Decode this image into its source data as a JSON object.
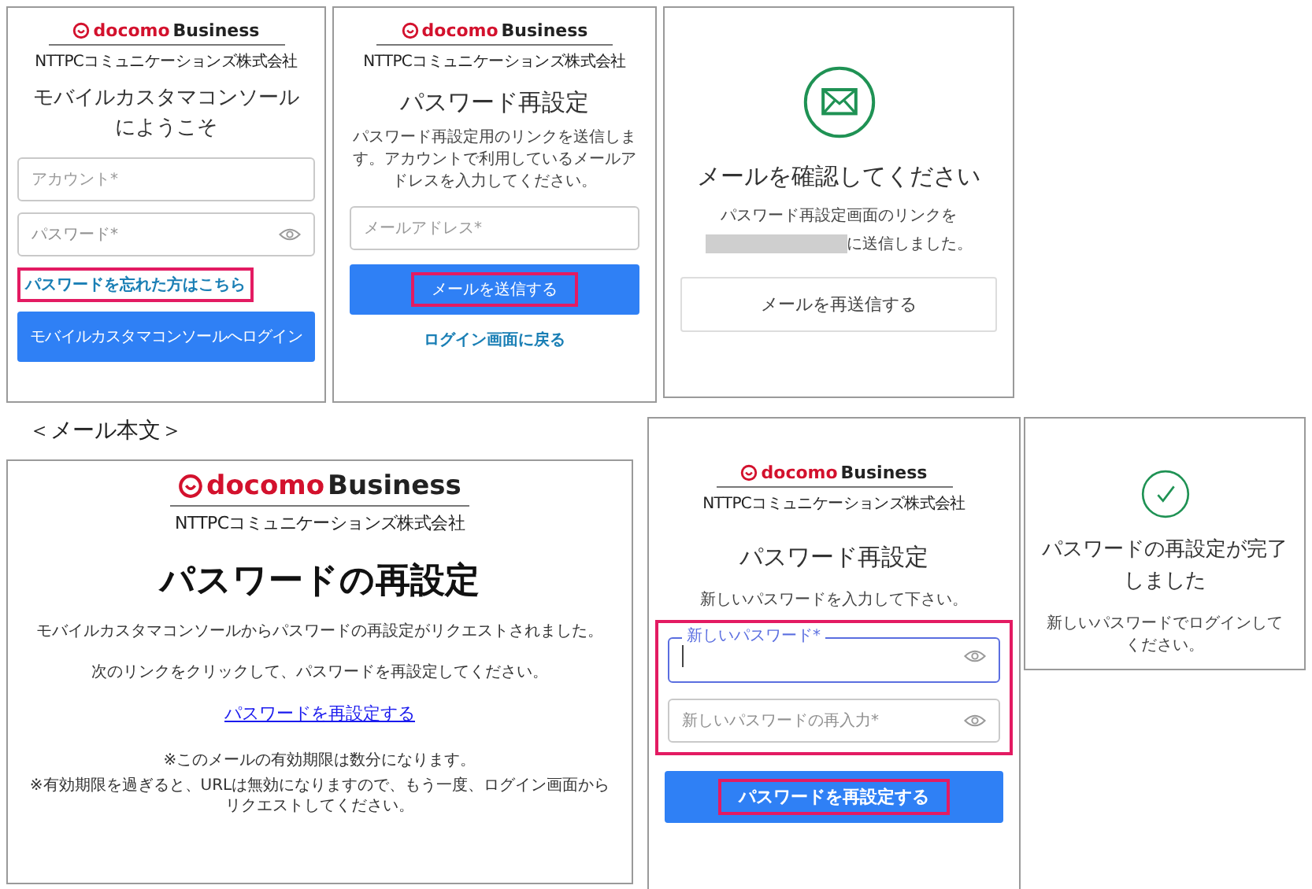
{
  "login_screen": {
    "logo": {
      "brand": "docomo",
      "suffix": "Business",
      "company": "NTTPCコミュニケーションズ株式会社"
    },
    "title_lines": [
      "モバイルカスタマコンソール",
      "にようこそ"
    ],
    "fields": [
      {
        "placeholder": "アカウント*",
        "kind": "text",
        "focused": false
      },
      {
        "placeholder": "パスワード*",
        "kind": "password",
        "focused": false
      }
    ],
    "forgot_link": {
      "label": "パスワードを忘れた方はこちら",
      "highlighted": true
    },
    "login_button": {
      "label": "モバイルカスタマコンソールへログイン"
    }
  },
  "reset_request_screen": {
    "logo": {
      "brand": "docomo",
      "suffix": "Business",
      "company": "NTTPCコミュニケーションズ株式会社"
    },
    "title": "パスワード再設定",
    "description": "パスワード再設定用のリンクを送信します。アカウントで利用しているメールアドレスを入力してください。",
    "field": {
      "placeholder": "メールアドレス*",
      "kind": "text",
      "focused": false
    },
    "send_button": {
      "label": "メールを送信する",
      "highlighted": true
    },
    "back_link": "ログイン画面に戻る"
  },
  "mail_sent_screen": {
    "title": "メールを確認してください",
    "message_line_1": "パスワード再設定画面のリンクを",
    "recipient_redacted": true,
    "message_line_2": "に送信しました。",
    "resend_button": "メールを再送信する"
  },
  "mail_body_caption": "＜メール本文＞",
  "mail_body": {
    "logo": {
      "brand": "docomo",
      "suffix": "Business",
      "company": "NTTPCコミュニケーションズ株式会社"
    },
    "title": "パスワードの再設定",
    "paragraphs": [
      "モバイルカスタマコンソールからパスワードの再設定がリクエストされました。",
      "次のリンクをクリックして、パスワードを再設定してください。"
    ],
    "link": "パスワードを再設定する",
    "notes": [
      "※このメールの有効期限は数分になります。",
      "※有効期限を過ぎると、URLは無効になりますので、もう一度、ログイン画面からリクエストしてください。"
    ]
  },
  "new_password_screen": {
    "logo": {
      "brand": "docomo",
      "suffix": "Business",
      "company": "NTTPCコミュニケーションズ株式会社"
    },
    "title": "パスワード再設定",
    "instruction": "新しいパスワードを入力して下さい。",
    "fields_highlighted": true,
    "fields": [
      {
        "placeholder": "新しいパスワード*",
        "kind": "password",
        "focused": true
      },
      {
        "placeholder": "新しいパスワードの再入力*",
        "kind": "password",
        "focused": false
      }
    ],
    "reset_button": {
      "label": "パスワードを再設定する",
      "highlighted": true
    }
  },
  "complete_screen": {
    "title": "パスワードの再設定が完了しました",
    "message": "新しいパスワードでログインしてください。"
  }
}
